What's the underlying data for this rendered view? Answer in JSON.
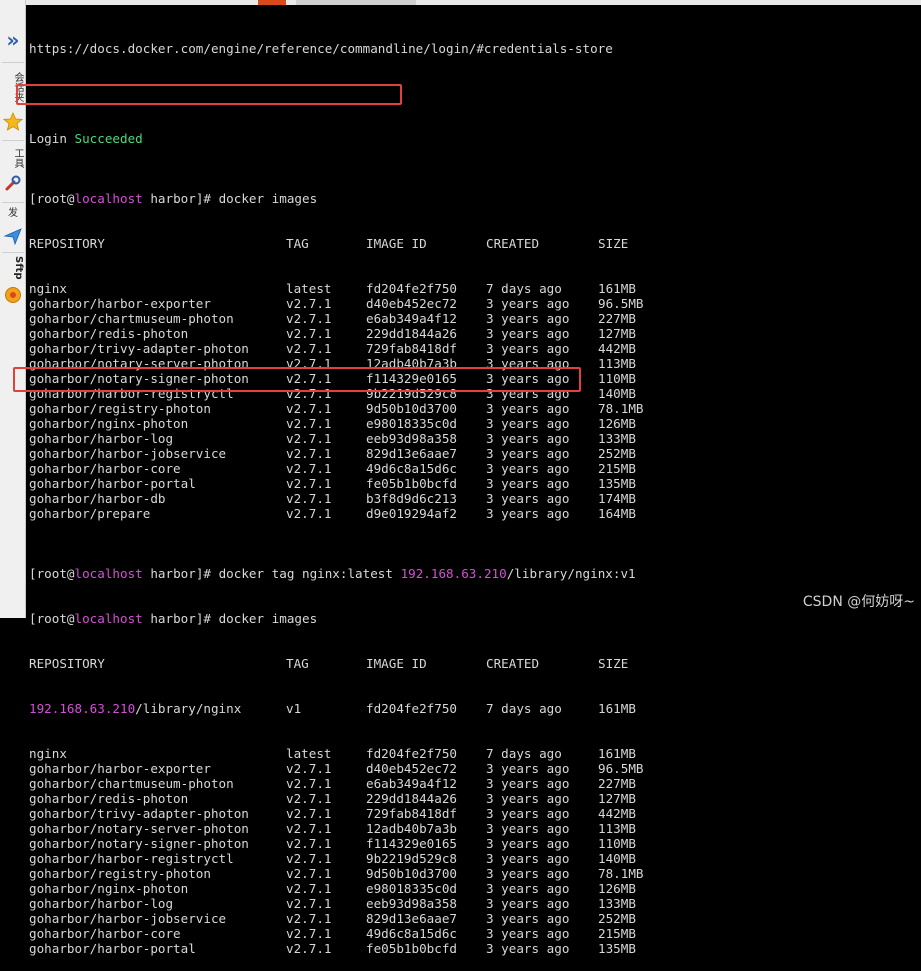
{
  "terminal": {
    "url_line": "https://docs.docker.com/engine/reference/commandline/login/#credentials-store",
    "login": {
      "prefix": "Login ",
      "status": "Succeeded"
    },
    "prompt": {
      "open": "[root@",
      "host": "localhost",
      "close": " harbor]# "
    },
    "cmd_images": "docker images",
    "cmd_tag": {
      "text": "docker tag nginx:latest ",
      "ip": "192.168.63.210",
      "rest": "/library/nginx:v1"
    },
    "headers": [
      "REPOSITORY",
      "TAG",
      "IMAGE ID",
      "CREATED",
      "SIZE"
    ],
    "images_first": [
      [
        "nginx",
        "latest",
        "fd204fe2f750",
        "7 days ago",
        "161MB"
      ],
      [
        "goharbor/harbor-exporter",
        "v2.7.1",
        "d40eb452ec72",
        "3 years ago",
        "96.5MB"
      ],
      [
        "goharbor/chartmuseum-photon",
        "v2.7.1",
        "e6ab349a4f12",
        "3 years ago",
        "227MB"
      ],
      [
        "goharbor/redis-photon",
        "v2.7.1",
        "229dd1844a26",
        "3 years ago",
        "127MB"
      ],
      [
        "goharbor/trivy-adapter-photon",
        "v2.7.1",
        "729fab8418df",
        "3 years ago",
        "442MB"
      ],
      [
        "goharbor/notary-server-photon",
        "v2.7.1",
        "12adb40b7a3b",
        "3 years ago",
        "113MB"
      ],
      [
        "goharbor/notary-signer-photon",
        "v2.7.1",
        "f114329e0165",
        "3 years ago",
        "110MB"
      ],
      [
        "goharbor/harbor-registryctl",
        "v2.7.1",
        "9b2219d529c8",
        "3 years ago",
        "140MB"
      ],
      [
        "goharbor/registry-photon",
        "v2.7.1",
        "9d50b10d3700",
        "3 years ago",
        "78.1MB"
      ],
      [
        "goharbor/nginx-photon",
        "v2.7.1",
        "e98018335c0d",
        "3 years ago",
        "126MB"
      ],
      [
        "goharbor/harbor-log",
        "v2.7.1",
        "eeb93d98a358",
        "3 years ago",
        "133MB"
      ],
      [
        "goharbor/harbor-jobservice",
        "v2.7.1",
        "829d13e6aae7",
        "3 years ago",
        "252MB"
      ],
      [
        "goharbor/harbor-core",
        "v2.7.1",
        "49d6c8a15d6c",
        "3 years ago",
        "215MB"
      ],
      [
        "goharbor/harbor-portal",
        "v2.7.1",
        "fe05b1b0bcfd",
        "3 years ago",
        "135MB"
      ],
      [
        "goharbor/harbor-db",
        "v2.7.1",
        "b3f8d9d6c213",
        "3 years ago",
        "174MB"
      ],
      [
        "goharbor/prepare",
        "v2.7.1",
        "d9e019294af2",
        "3 years ago",
        "164MB"
      ]
    ],
    "tagged_row": {
      "ip": "192.168.63.210",
      "repo_rest": "/library/nginx",
      "tag": "v1",
      "id": "fd204fe2f750",
      "created": "7 days ago",
      "size": "161MB"
    },
    "images_second": [
      [
        "nginx",
        "latest",
        "fd204fe2f750",
        "7 days ago",
        "161MB"
      ],
      [
        "goharbor/harbor-exporter",
        "v2.7.1",
        "d40eb452ec72",
        "3 years ago",
        "96.5MB"
      ],
      [
        "goharbor/chartmuseum-photon",
        "v2.7.1",
        "e6ab349a4f12",
        "3 years ago",
        "227MB"
      ],
      [
        "goharbor/redis-photon",
        "v2.7.1",
        "229dd1844a26",
        "3 years ago",
        "127MB"
      ],
      [
        "goharbor/trivy-adapter-photon",
        "v2.7.1",
        "729fab8418df",
        "3 years ago",
        "442MB"
      ],
      [
        "goharbor/notary-server-photon",
        "v2.7.1",
        "12adb40b7a3b",
        "3 years ago",
        "113MB"
      ],
      [
        "goharbor/notary-signer-photon",
        "v2.7.1",
        "f114329e0165",
        "3 years ago",
        "110MB"
      ],
      [
        "goharbor/harbor-registryctl",
        "v2.7.1",
        "9b2219d529c8",
        "3 years ago",
        "140MB"
      ],
      [
        "goharbor/registry-photon",
        "v2.7.1",
        "9d50b10d3700",
        "3 years ago",
        "78.1MB"
      ],
      [
        "goharbor/nginx-photon",
        "v2.7.1",
        "e98018335c0d",
        "3 years ago",
        "126MB"
      ],
      [
        "goharbor/harbor-log",
        "v2.7.1",
        "eeb93d98a358",
        "3 years ago",
        "133MB"
      ],
      [
        "goharbor/harbor-jobservice",
        "v2.7.1",
        "829d13e6aae7",
        "3 years ago",
        "252MB"
      ],
      [
        "goharbor/harbor-core",
        "v2.7.1",
        "49d6c8a15d6c",
        "3 years ago",
        "215MB"
      ],
      [
        "goharbor/harbor-portal",
        "v2.7.1",
        "fe05b1b0bcfd",
        "3 years ago",
        "135MB"
      ]
    ]
  },
  "sidebar": {
    "expand_glyph": "»",
    "labels": [
      "会话夹",
      "工具",
      "发",
      "Sftp"
    ]
  },
  "watermark": "CSDN @何妨呀~",
  "colors": {
    "background": "#000000",
    "text": "#d8d8d8",
    "host": "#d54fd5",
    "success": "#4ed67c",
    "highlight": "#e0413b"
  }
}
